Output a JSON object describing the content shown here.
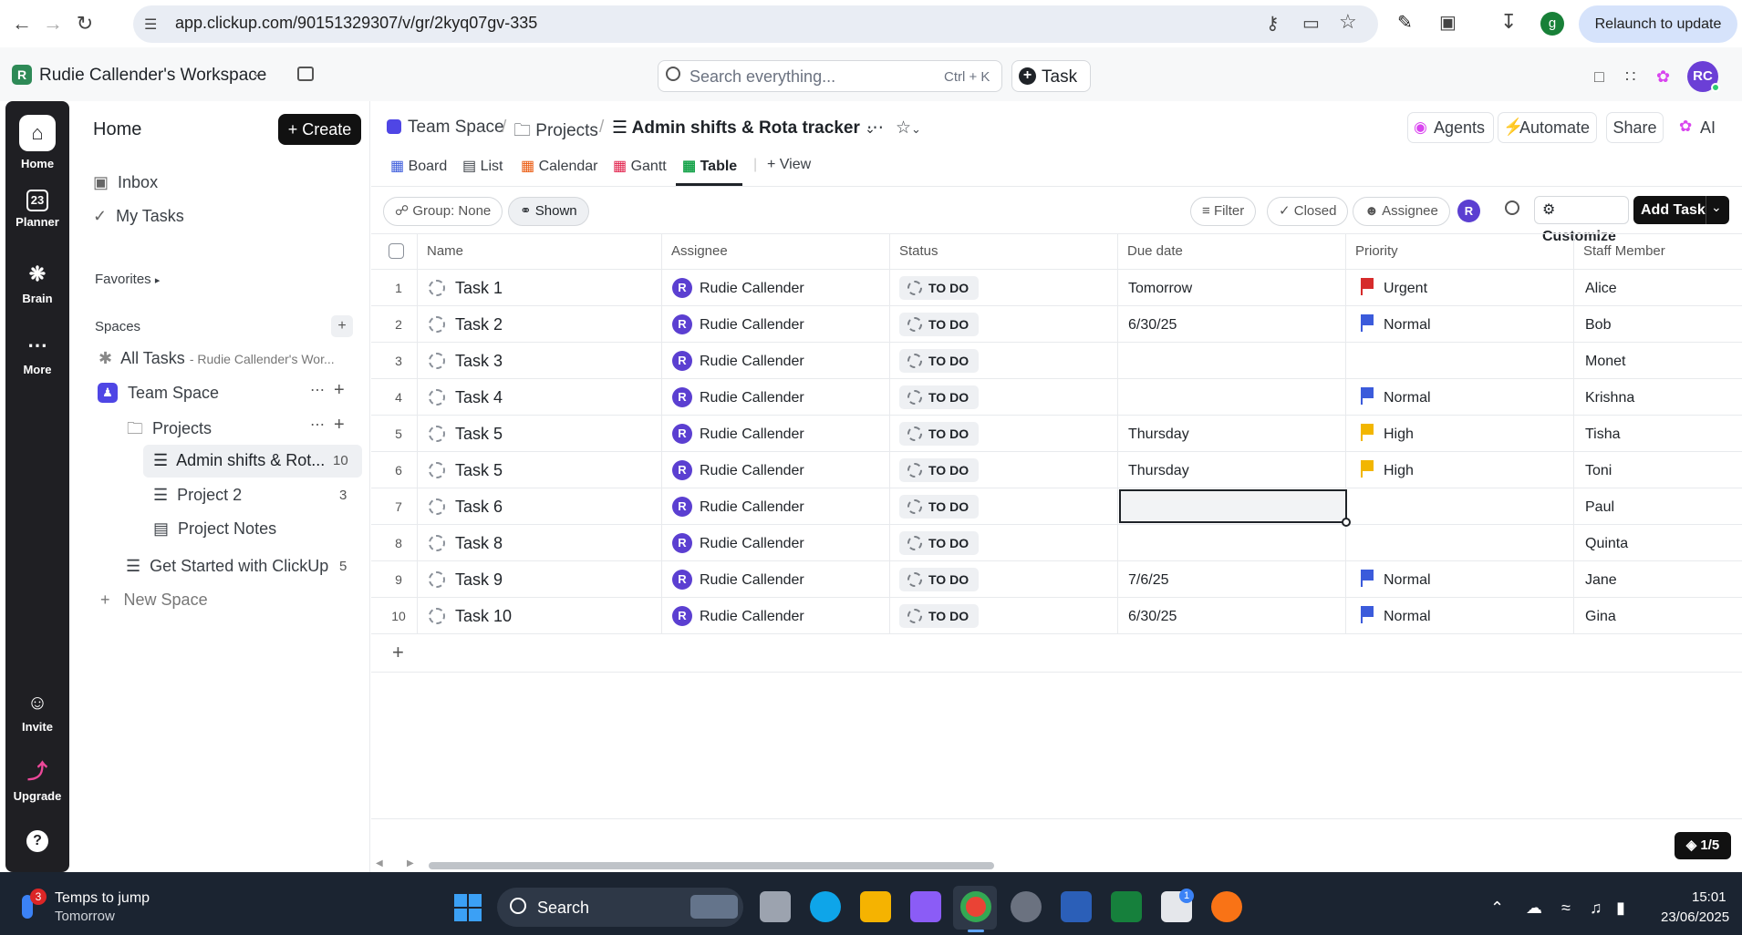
{
  "browser": {
    "url": "app.clickup.com/90151329307/v/gr/2kyq07gv-335",
    "relaunch_label": "Relaunch to update",
    "profile_initial": "g"
  },
  "topbar": {
    "workspace_initial": "R",
    "workspace_name": "Rudie Callender's Workspace",
    "search_placeholder": "Search everything...",
    "search_shortcut": "Ctrl + K",
    "task_label": "Task",
    "avatar": "RC"
  },
  "rail": {
    "items": [
      {
        "label": "Home",
        "icon": "home-icon"
      },
      {
        "label": "Planner",
        "icon": "calendar-icon"
      },
      {
        "label": "Brain",
        "icon": "brain-icon"
      },
      {
        "label": "More",
        "icon": "more-icon"
      },
      {
        "label": "Invite",
        "icon": "invite-icon"
      },
      {
        "label": "Upgrade",
        "icon": "upgrade-icon"
      }
    ],
    "planner_day": "23"
  },
  "sidebar": {
    "title": "Home",
    "create_label": "Create",
    "inbox": "Inbox",
    "my_tasks": "My Tasks",
    "favorites": "Favorites",
    "spaces": "Spaces",
    "all_tasks": "All Tasks",
    "all_tasks_sub": "- Rudie Callender's Wor...",
    "team_space": "Team Space",
    "projects": "Projects",
    "admin": "Admin shifts & Rot...",
    "admin_count": "10",
    "project2": "Project 2",
    "project2_count": "3",
    "project_notes": "Project Notes",
    "get_started": "Get Started with ClickUp",
    "get_started_count": "5",
    "new_space": "New Space"
  },
  "breadcrumb": {
    "space": "Team Space",
    "folder": "Projects",
    "list": "Admin shifts & Rota tracker"
  },
  "header_actions": {
    "agents": "Agents",
    "automate": "Automate",
    "share": "Share",
    "ai": "AI"
  },
  "views": {
    "board": "Board",
    "list": "List",
    "calendar": "Calendar",
    "gantt": "Gantt",
    "table": "Table",
    "add_view": "View"
  },
  "toolbar": {
    "group": "Group: None",
    "shown": "Shown",
    "filter": "Filter",
    "closed": "Closed",
    "assignee": "Assignee",
    "assignee_initial": "R",
    "customize": "Customize",
    "add_task": "Add Task"
  },
  "table": {
    "columns": [
      "Name",
      "Assignee",
      "Status",
      "Due date",
      "Priority",
      "Staff Member"
    ],
    "rows": [
      {
        "num": "1",
        "name": "Task 1",
        "assignee": "Rudie Callender",
        "status": "TO DO",
        "due": "Tomorrow",
        "priority": "Urgent",
        "priority_color": "#d62b2b",
        "staff": "Alice"
      },
      {
        "num": "2",
        "name": "Task 2",
        "assignee": "Rudie Callender",
        "status": "TO DO",
        "due": "6/30/25",
        "priority": "Normal",
        "priority_color": "#3b5bdb",
        "staff": "Bob"
      },
      {
        "num": "3",
        "name": "Task 3",
        "assignee": "Rudie Callender",
        "status": "TO DO",
        "due": "",
        "priority": "",
        "priority_color": "",
        "staff": "Monet"
      },
      {
        "num": "4",
        "name": "Task 4",
        "assignee": "Rudie Callender",
        "status": "TO DO",
        "due": "",
        "priority": "Normal",
        "priority_color": "#3b5bdb",
        "staff": "Krishna"
      },
      {
        "num": "5",
        "name": "Task 5",
        "assignee": "Rudie Callender",
        "status": "TO DO",
        "due": "Thursday",
        "priority": "High",
        "priority_color": "#f2b600",
        "staff": "Tisha"
      },
      {
        "num": "6",
        "name": "Task 5",
        "assignee": "Rudie Callender",
        "status": "TO DO",
        "due": "Thursday",
        "priority": "High",
        "priority_color": "#f2b600",
        "staff": "Toni"
      },
      {
        "num": "7",
        "name": "Task 6",
        "assignee": "Rudie Callender",
        "status": "TO DO",
        "due": "",
        "priority": "",
        "priority_color": "",
        "staff": "Paul"
      },
      {
        "num": "8",
        "name": "Task 8",
        "assignee": "Rudie Callender",
        "status": "TO DO",
        "due": "",
        "priority": "",
        "priority_color": "",
        "staff": "Quinta"
      },
      {
        "num": "9",
        "name": "Task 9",
        "assignee": "Rudie Callender",
        "status": "TO DO",
        "due": "7/6/25",
        "priority": "Normal",
        "priority_color": "#3b5bdb",
        "staff": "Jane"
      },
      {
        "num": "10",
        "name": "Task 10",
        "assignee": "Rudie Callender",
        "status": "TO DO",
        "due": "6/30/25",
        "priority": "Normal",
        "priority_color": "#3b5bdb",
        "staff": "Gina"
      }
    ],
    "assignee_initial": "R",
    "page_indicator": "1/5"
  },
  "taskbar": {
    "weather_badge": "3",
    "weather_title": "Temps to jump",
    "weather_sub": "Tomorrow",
    "search": "Search",
    "time": "15:01",
    "date": "23/06/2025",
    "store_badge": "1"
  }
}
